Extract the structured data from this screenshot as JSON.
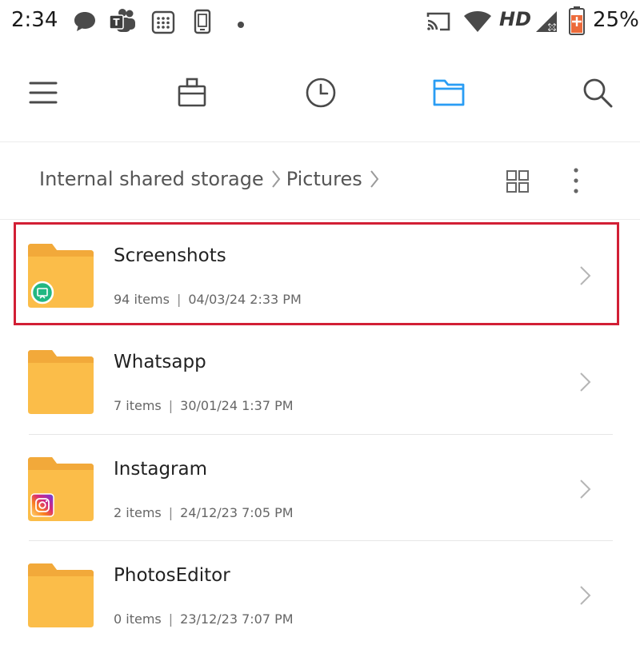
{
  "status_bar": {
    "time": "2:34",
    "network_label": "HD",
    "battery_percent": "25%",
    "notification_icons": [
      "chat-bubble-icon",
      "teams-icon",
      "calculator-icon",
      "phone-device-icon",
      "dot-icon"
    ],
    "system_icons": [
      "cast-icon",
      "wifi-icon",
      "signal-icon",
      "battery-icon"
    ]
  },
  "toolbar": {
    "icons": [
      "menu-icon",
      "briefcase-icon",
      "clock-icon",
      "folder-icon",
      "search-icon"
    ],
    "active_color": "#2a9df4",
    "inactive_color": "#4a4a4a"
  },
  "breadcrumb": {
    "items": [
      "Internal shared storage",
      "Pictures"
    ]
  },
  "folders": [
    {
      "name": "Screenshots",
      "items": "94 items",
      "date": "04/03/24 2:33 PM",
      "badge": "screenshot-badge-icon",
      "highlighted": true
    },
    {
      "name": "Whatsapp",
      "items": "7 items",
      "date": "30/01/24 1:37 PM",
      "badge": "",
      "highlighted": false
    },
    {
      "name": "Instagram",
      "items": "2 items",
      "date": "24/12/23 7:05 PM",
      "badge": "instagram-badge-icon",
      "highlighted": false
    },
    {
      "name": "PhotosEditor",
      "items": "0 items",
      "date": "23/12/23 7:07 PM",
      "badge": "",
      "highlighted": false
    }
  ],
  "colors": {
    "folder": "#fbbd49",
    "folder_tab": "#f2a93a",
    "highlight": "#d21f35",
    "screenshot_badge": "#22b782"
  }
}
